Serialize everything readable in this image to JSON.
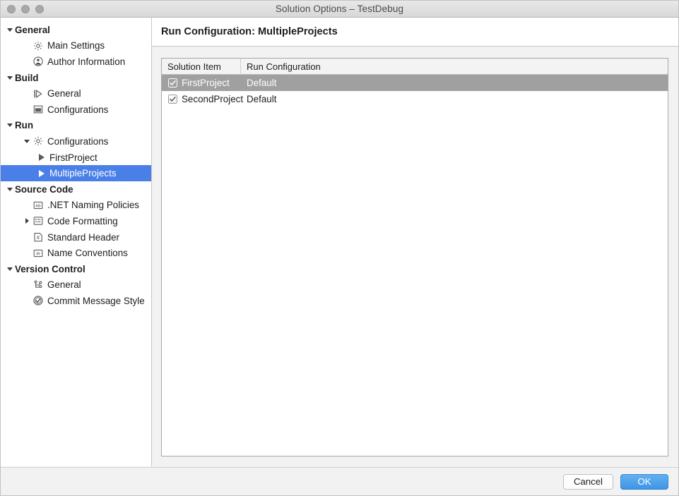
{
  "window": {
    "title": "Solution Options – TestDebug",
    "traffic_lights": [
      "close-button",
      "minimize-button",
      "zoom-button"
    ]
  },
  "colors": {
    "sidebar_selection": "#4a7fe8",
    "table_row_selection": "#a0a0a0",
    "primary_button": "#4a9de8",
    "titlebar": "#e0e0e0",
    "panel_background": "#f2f2f2"
  },
  "sidebar": {
    "items": [
      {
        "label": "General",
        "level": 0,
        "type": "group",
        "twisty": "down",
        "icon": "none",
        "selected": false
      },
      {
        "label": "Main Settings",
        "level": 1,
        "type": "item",
        "twisty": "none",
        "icon": "gear-icon",
        "selected": false
      },
      {
        "label": "Author Information",
        "level": 1,
        "type": "item",
        "twisty": "none",
        "icon": "person-icon",
        "selected": false
      },
      {
        "label": "Build",
        "level": 0,
        "type": "group",
        "twisty": "down",
        "icon": "none",
        "selected": false
      },
      {
        "label": "General",
        "level": 1,
        "type": "item",
        "twisty": "none",
        "icon": "build-icon",
        "selected": false
      },
      {
        "label": "Configurations",
        "level": 1,
        "type": "item",
        "twisty": "none",
        "icon": "window-icon",
        "selected": false
      },
      {
        "label": "Run",
        "level": 0,
        "type": "group",
        "twisty": "down",
        "icon": "none",
        "selected": false
      },
      {
        "label": "Configurations",
        "level": 1,
        "type": "item",
        "twisty": "down",
        "icon": "gear-icon",
        "selected": false
      },
      {
        "label": "FirstProject",
        "level": 2,
        "type": "item",
        "twisty": "none",
        "icon": "run-arrow-icon",
        "selected": false
      },
      {
        "label": "MultipleProjects",
        "level": 2,
        "type": "item",
        "twisty": "none",
        "icon": "run-arrow-icon",
        "selected": true
      },
      {
        "label": "Source Code",
        "level": 0,
        "type": "group",
        "twisty": "down",
        "icon": "none",
        "selected": false
      },
      {
        "label": ".NET Naming Policies",
        "level": 1,
        "type": "item",
        "twisty": "none",
        "icon": "ab-box-icon",
        "selected": false
      },
      {
        "label": "Code Formatting",
        "level": 1,
        "type": "item",
        "twisty": "right",
        "icon": "format-list-icon",
        "selected": false
      },
      {
        "label": "Standard Header",
        "level": 1,
        "type": "item",
        "twisty": "none",
        "icon": "hash-doc-icon",
        "selected": false
      },
      {
        "label": "Name Conventions",
        "level": 1,
        "type": "item",
        "twisty": "none",
        "icon": "ir-box-icon",
        "selected": false
      },
      {
        "label": "Version Control",
        "level": 0,
        "type": "group",
        "twisty": "down",
        "icon": "none",
        "selected": false
      },
      {
        "label": "General",
        "level": 1,
        "type": "item",
        "twisty": "none",
        "icon": "branch-icon",
        "selected": false
      },
      {
        "label": "Commit Message Style",
        "level": 1,
        "type": "item",
        "twisty": "none",
        "icon": "check-circle-icon",
        "selected": false
      }
    ]
  },
  "main": {
    "pane_title": "Run Configuration: MultipleProjects",
    "table": {
      "columns": [
        "Solution Item",
        "Run Configuration"
      ],
      "rows": [
        {
          "checked": true,
          "name": "FirstProject",
          "run_configuration": "Default",
          "selected": true
        },
        {
          "checked": true,
          "name": "SecondProject",
          "run_configuration": "Default",
          "selected": false
        }
      ]
    }
  },
  "footer": {
    "cancel_label": "Cancel",
    "ok_label": "OK"
  }
}
